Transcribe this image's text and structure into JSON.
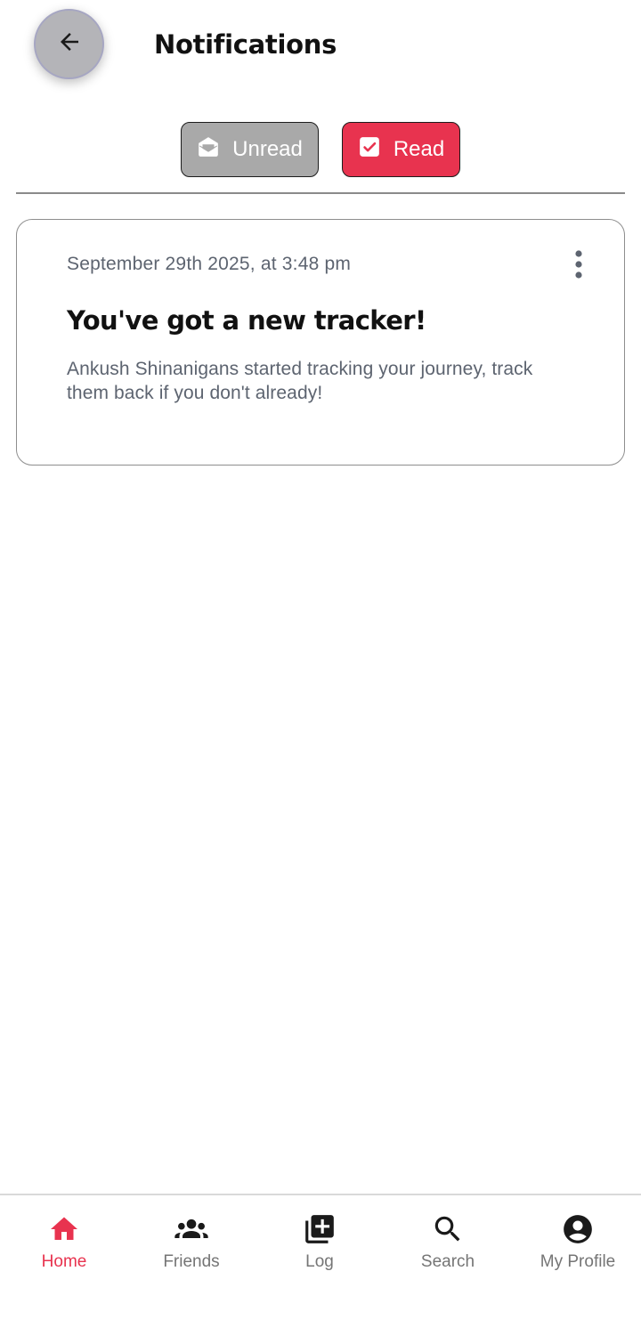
{
  "header": {
    "title": "Notifications",
    "back_icon": "arrow-left-icon"
  },
  "filters": {
    "unread_label": "Unread",
    "unread_icon": "envelope-open-icon",
    "read_label": "Read",
    "read_icon": "check-square-icon",
    "selected": "Read"
  },
  "notifications": [
    {
      "date": "September 29th 2025, at 3:48 pm",
      "title": "You've got a new tracker!",
      "body": "Ankush Shinanigans started tracking your journey, track them back if you don't already!",
      "menu_icon": "more-vertical-icon"
    }
  ],
  "nav": {
    "active": "Home",
    "items": [
      {
        "label": "Home",
        "icon": "home-icon"
      },
      {
        "label": "Friends",
        "icon": "group-icon"
      },
      {
        "label": "Log",
        "icon": "add-library-icon"
      },
      {
        "label": "Search",
        "icon": "search-icon"
      },
      {
        "label": "My Profile",
        "icon": "account-circle-icon"
      }
    ]
  },
  "colors": {
    "accent": "#e8334f",
    "unread_bg": "#a9a9a9",
    "muted_text": "#5d6470",
    "nav_inactive": "#757575"
  }
}
